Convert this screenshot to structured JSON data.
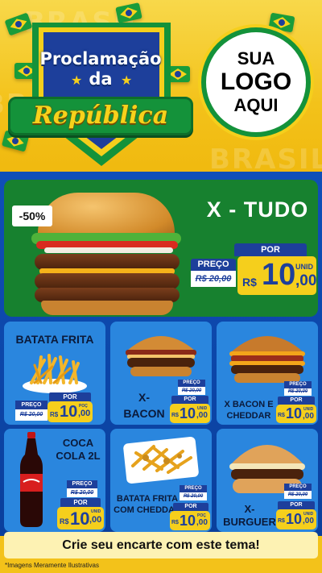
{
  "header": {
    "badge_line1": "Proclamação",
    "badge_line2": "da",
    "badge_ribbon": "República",
    "logo_lines": [
      "SUA",
      "LOGO",
      "AQUI"
    ],
    "bg_word": "BRASIL"
  },
  "hero": {
    "title": "X - TUDO",
    "discount": "-50%",
    "preco_label": "PREÇO",
    "old_price": "R$ 20,00",
    "por_label": "POR",
    "currency": "R$",
    "price_int": "10",
    "price_cents": ",00",
    "unit": "UNID"
  },
  "products": [
    {
      "name": "BATATA FRITA",
      "preco_label": "PREÇO",
      "old_price": "R$ 20,00",
      "por_label": "POR",
      "currency": "R$",
      "price_int": "10",
      "price_cents": ",00",
      "unit": "POÇ"
    },
    {
      "name": "X-BACON",
      "preco_label": "PREÇO",
      "old_price": "R$ 20,00",
      "por_label": "POR",
      "currency": "R$",
      "price_int": "10",
      "price_cents": ",00",
      "unit": "UNID"
    },
    {
      "name": "X BACON E CHEDDAR",
      "preco_label": "PREÇO",
      "old_price": "R$ 20,00",
      "por_label": "POR",
      "currency": "R$",
      "price_int": "10",
      "price_cents": ",00",
      "unit": "UNID"
    },
    {
      "name": "COCA COLA 2L",
      "preco_label": "PREÇO",
      "old_price": "R$ 20,00",
      "por_label": "POR",
      "currency": "R$",
      "price_int": "10",
      "price_cents": ",00",
      "unit": "UNID"
    },
    {
      "name": "BATATA FRITA COM CHEDDAR",
      "preco_label": "PREÇO",
      "old_price": "R$ 20,00",
      "por_label": "POR",
      "currency": "R$",
      "price_int": "10",
      "price_cents": ",00",
      "unit": "POÇ"
    },
    {
      "name": "X-BURGUER",
      "preco_label": "PREÇO",
      "old_price": "R$ 20,00",
      "por_label": "POR",
      "currency": "R$",
      "price_int": "10",
      "price_cents": ",00",
      "unit": "UNID"
    }
  ],
  "footer": {
    "cta": "Crie seu encarte com este tema!",
    "disclaimer": "*Imagens Meramente Ilustrativas"
  },
  "colors": {
    "green": "#17812f",
    "blue": "#1d3f9b",
    "yellow": "#f5cf1c",
    "card_blue": "#2a86de"
  }
}
